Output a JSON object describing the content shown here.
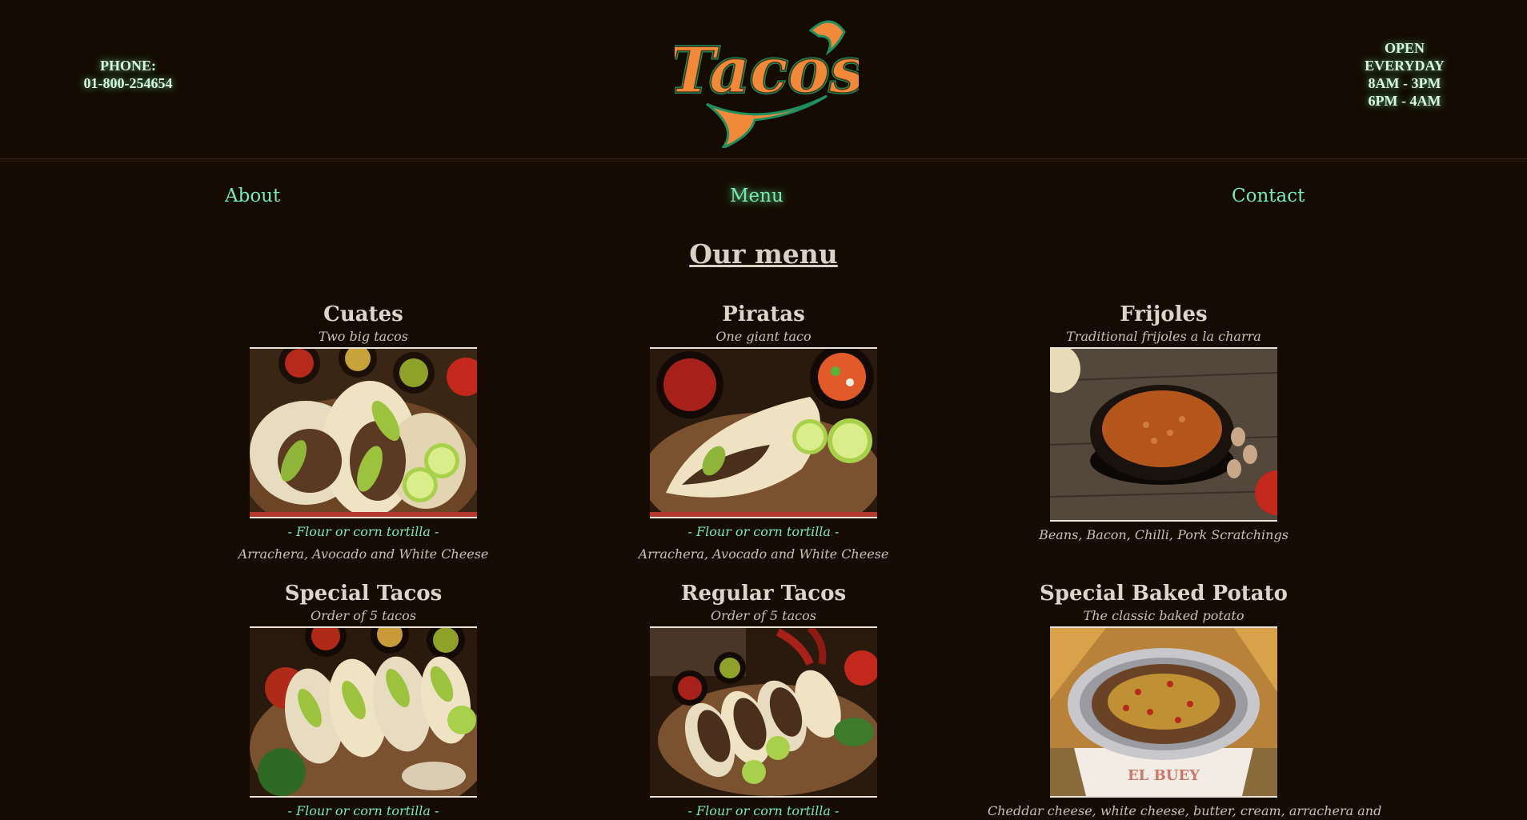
{
  "header": {
    "phone_label": "PHONE:",
    "phone_number": "01-800-254654",
    "hours": [
      "OPEN",
      "EVERYDAY",
      "8AM - 3PM",
      "6PM - 4AM"
    ],
    "logo_text": "Tacos"
  },
  "nav": {
    "about": "About",
    "menu": "Menu",
    "contact": "Contact"
  },
  "page_title": "Our menu",
  "menu_items": [
    {
      "name": "Cuates",
      "subtitle": "Two big tacos",
      "tortilla": "- Flour or corn tortilla -",
      "description": "Arrachera, Avocado and White Cheese"
    },
    {
      "name": "Piratas",
      "subtitle": "One giant taco",
      "tortilla": "- Flour or corn tortilla -",
      "description": "Arrachera, Avocado and White Cheese"
    },
    {
      "name": "Frijoles",
      "subtitle": "Traditional frijoles a la charra",
      "description": "Beans, Bacon, Chilli, Pork Scratchings"
    },
    {
      "name": "Special Tacos",
      "subtitle": "Order of 5 tacos",
      "tortilla": "- Flour or corn tortilla -"
    },
    {
      "name": "Regular Tacos",
      "subtitle": "Order of 5 tacos",
      "tortilla": "- Flour or corn tortilla -"
    },
    {
      "name": "Special Baked Potato",
      "subtitle": "The classic baked potato",
      "description": "Cheddar cheese, white cheese, butter, cream, arrachera and"
    }
  ],
  "colors": {
    "background": "#150b03",
    "accent_green": "#77ecb0",
    "text": "#d9d2c3",
    "red_line": "#b43a2f"
  }
}
